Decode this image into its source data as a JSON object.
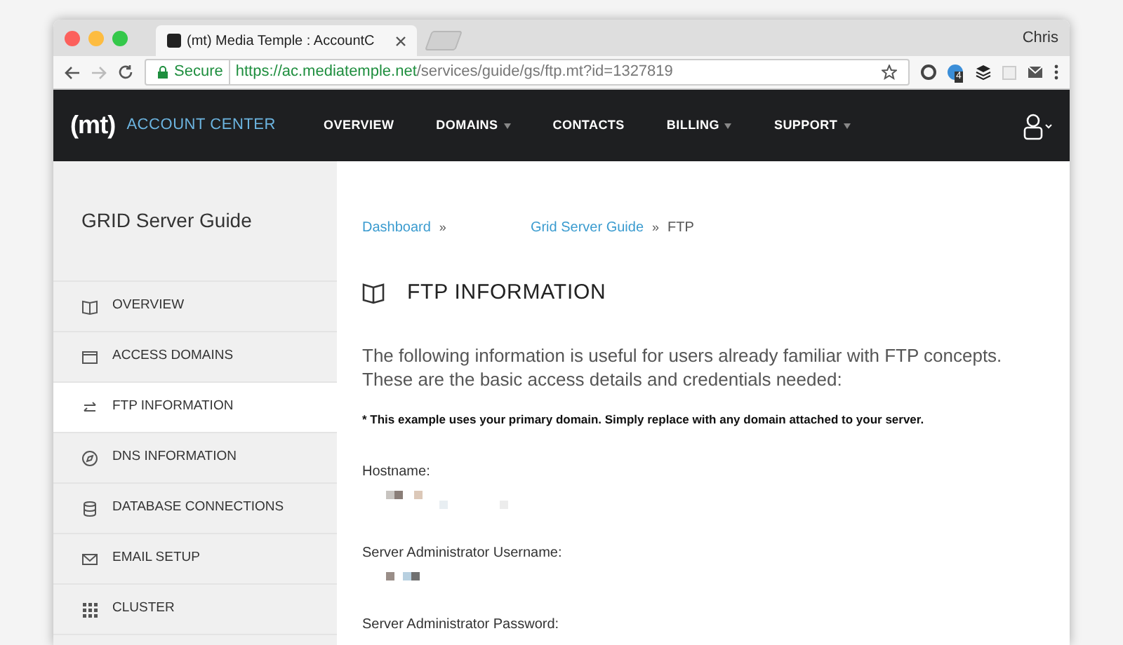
{
  "browser": {
    "tab_title": "(mt) Media Temple : AccountC",
    "user": "Chris",
    "secure_label": "Secure",
    "url_host": "https://ac.mediatemple.net",
    "url_path": "/services/guide/gs/ftp.mt?id=1327819",
    "extension_badge": "4"
  },
  "header": {
    "logo": "(mt)",
    "brand": "ACCOUNT CENTER",
    "nav": [
      {
        "label": "OVERVIEW",
        "has_menu": false
      },
      {
        "label": "DOMAINS",
        "has_menu": true
      },
      {
        "label": "CONTACTS",
        "has_menu": false
      },
      {
        "label": "BILLING",
        "has_menu": true
      },
      {
        "label": "SUPPORT",
        "has_menu": true
      }
    ]
  },
  "sidebar": {
    "title": "GRID Server Guide",
    "items": [
      {
        "label": "OVERVIEW",
        "kind": "book",
        "selected": false
      },
      {
        "label": "ACCESS DOMAINS",
        "kind": "window",
        "selected": false
      },
      {
        "label": "FTP INFORMATION",
        "kind": "arrows",
        "selected": true
      },
      {
        "label": "DNS INFORMATION",
        "kind": "compass",
        "selected": false
      },
      {
        "label": "DATABASE CONNECTIONS",
        "kind": "database",
        "selected": false
      },
      {
        "label": "EMAIL SETUP",
        "kind": "mail",
        "selected": false
      },
      {
        "label": "CLUSTER",
        "kind": "grid",
        "selected": false
      }
    ]
  },
  "breadcrumbs": [
    {
      "label": "Dashboard",
      "kind": "link",
      "separator": "»"
    },
    {
      "label": "Grid Server Guide",
      "kind": "link",
      "separator": "»"
    },
    {
      "label": "FTP",
      "kind": "current"
    }
  ],
  "heading": "FTP INFORMATION",
  "intro": "The following information is useful for users already familiar with FTP concepts. These are the basic access details and credentials needed:",
  "note": "* This example uses your primary domain. Simply replace with any domain attached to your server.",
  "fields": [
    {
      "label": "Hostname:",
      "redacted": true
    },
    {
      "label": "Server Administrator Username:",
      "redacted": true
    },
    {
      "label": "Server Administrator Password:"
    }
  ]
}
